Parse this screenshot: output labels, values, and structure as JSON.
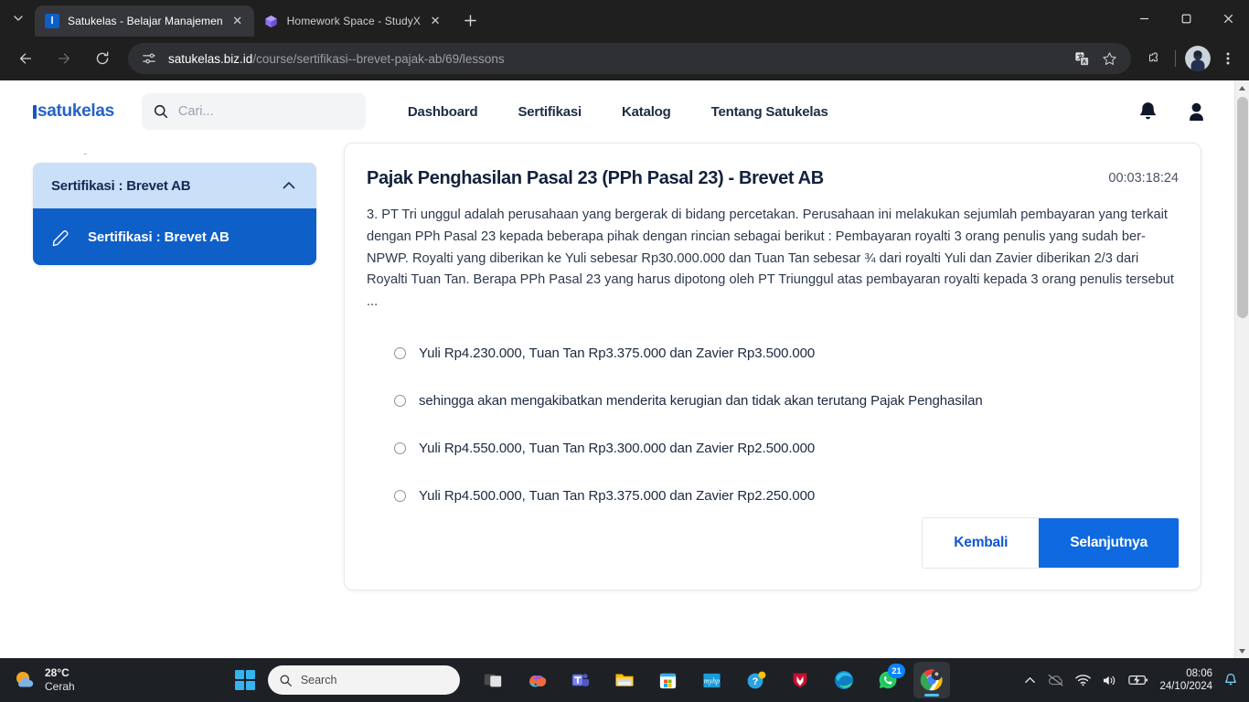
{
  "browser": {
    "tabs": [
      {
        "title": "Satukelas - Belajar Manajemen",
        "favicon": "satukelas-favicon",
        "active": true
      },
      {
        "title": "Homework Space - StudyX",
        "favicon": "studyx-favicon",
        "active": false
      }
    ],
    "new_tab_label": "+",
    "tab_search_label": "v",
    "window_controls": {
      "minimize": "—",
      "maximize": "□",
      "close": "✕"
    },
    "omnibox": {
      "host": "satukelas.biz.id",
      "path": "/course/sertifikasi--brevet-pajak-ab/69/lessons",
      "site_info_icon": "tune-icon",
      "translate_icon": "translate-icon",
      "bookmark_icon": "star-icon"
    },
    "nav": {
      "back": "back-icon",
      "forward": "forward-icon",
      "reload": "reload-icon"
    },
    "extensions_icon": "puzzle-icon",
    "menu_icon": "three-dot-icon"
  },
  "site": {
    "logo": "satukelas",
    "search": {
      "placeholder": "Cari...",
      "value": ""
    },
    "nav_items": [
      {
        "label": "Dashboard"
      },
      {
        "label": "Sertifikasi"
      },
      {
        "label": "Katalog"
      },
      {
        "label": "Tentang Satukelas"
      }
    ],
    "notification_icon": "bell-icon",
    "account_icon": "user-avatar-icon"
  },
  "sidebar": {
    "stub_text": "-",
    "accordion": {
      "header_label": "Sertifikasi : Brevet AB",
      "chevron": "chevron-up-icon",
      "items": [
        {
          "label": "Sertifikasi : Brevet AB",
          "icon": "pencil-icon",
          "active": true
        }
      ]
    }
  },
  "lesson": {
    "title": "Pajak Penghasilan Pasal 23 (PPh Pasal 23) - Brevet AB",
    "timer": "00:03:18:24",
    "question": "3. PT Tri unggul adalah perusahaan yang bergerak di bidang percetakan. Perusahaan ini melakukan sejumlah pembayaran yang terkait dengan PPh Pasal 23 kepada beberapa pihak dengan rincian sebagai berikut : Pembayaran royalti 3 orang penulis yang sudah ber-NPWP. Royalti yang diberikan ke Yuli sebesar Rp30.000.000 dan Tuan Tan sebesar ¾ dari royalti Yuli dan Zavier diberikan 2/3 dari Royalti Tuan Tan. Berapa PPh Pasal 23 yang harus dipotong oleh PT Triunggul atas pembayaran royalti kepada 3 orang penulis tersebut ...",
    "options": [
      {
        "label": "Yuli Rp4.230.000, Tuan Tan Rp3.375.000 dan Zavier Rp3.500.000",
        "selected": false
      },
      {
        "label": "sehingga akan mengakibatkan menderita kerugian dan tidak akan terutang Pajak Penghasilan",
        "selected": false
      },
      {
        "label": "Yuli Rp4.550.000, Tuan Tan Rp3.300.000 dan Zavier Rp2.500.000",
        "selected": false
      },
      {
        "label": "Yuli Rp4.500.000, Tuan Tan Rp3.375.000 dan Zavier Rp2.250.000",
        "selected": false
      }
    ],
    "back_button": "Kembali",
    "next_button": "Selanjutnya"
  },
  "taskbar": {
    "weather": {
      "temperature": "28°C",
      "condition": "Cerah",
      "icon": "partly-cloudy-icon"
    },
    "start_label": "start-icon",
    "search_placeholder": "Search",
    "apps": [
      {
        "name": "task-view",
        "badge": ""
      },
      {
        "name": "copilot",
        "badge": ""
      },
      {
        "name": "microsoft-teams",
        "badge": ""
      },
      {
        "name": "file-explorer",
        "badge": ""
      },
      {
        "name": "microsoft-store",
        "badge": ""
      },
      {
        "name": "myhp",
        "badge": ""
      },
      {
        "name": "help",
        "badge": ""
      },
      {
        "name": "mcafee",
        "badge": ""
      },
      {
        "name": "microsoft-edge",
        "badge": ""
      },
      {
        "name": "whatsapp",
        "badge": "21"
      },
      {
        "name": "google-chrome",
        "badge": ""
      }
    ],
    "tray": {
      "chevron": "show-hidden-icons",
      "onedrive": "onedrive-offline-icon",
      "network": "wifi-icon",
      "volume": "volume-icon",
      "battery": "battery-charging-icon",
      "notifications": "notification-bell-icon"
    },
    "clock": {
      "time": "08:06",
      "date": "24/10/2024"
    }
  },
  "colors": {
    "brand_blue": "#0f5fc9",
    "accent_blue": "#0f69e0",
    "sidebar_light": "#cadff8",
    "link_blue": "#1156d8"
  }
}
